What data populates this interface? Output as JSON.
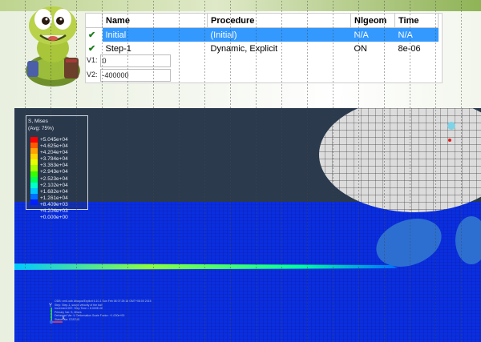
{
  "step_manager": {
    "columns": [
      "Name",
      "Procedure",
      "Nlgeom",
      "Time"
    ],
    "rows": [
      {
        "check": "✔",
        "name": "Initial",
        "procedure": "(Initial)",
        "nlgeom": "N/A",
        "time": "N/A",
        "selected": true
      },
      {
        "check": "✔",
        "name": "Step-1",
        "procedure": "Dynamic, Explicit",
        "nlgeom": "ON",
        "time": "8e-06",
        "selected": false
      }
    ]
  },
  "velocity_fields": [
    {
      "label": "V1:",
      "value": "0"
    },
    {
      "label": "V2:",
      "value": "-400000"
    }
  ],
  "legend": {
    "title_line1": "S, Mises",
    "title_line2": "(Avg: 75%)",
    "values": [
      "+5.045e+04",
      "+4.625e+04",
      "+4.204e+04",
      "+3.784e+04",
      "+3.363e+04",
      "+2.943e+04",
      "+2.523e+04",
      "+2.102e+04",
      "+1.682e+04",
      "+1.261e+04",
      "+8.409e+03",
      "+4.204e+03",
      "+0.000e+00"
    ],
    "colors": [
      "#ff0000",
      "#ff5a00",
      "#ffa200",
      "#ffd400",
      "#e8ff00",
      "#a8ff00",
      "#35ff00",
      "#00ff58",
      "#00ffcc",
      "#00c8ff",
      "#0070ff",
      "#0020ff",
      "#0000c8"
    ]
  },
  "odb_info": {
    "line1": "ODB: vm6.odb    Abaqus/Explicit 6.10-1    Sun Feb 08 07:25:18 GMT+08:00 2015",
    "line2": "Step: Step-1, susp4 velocity of the ball",
    "line3": "Increment    957: Step Time =  8.000E-06",
    "line4": "Primary Var: S, Mises",
    "line5": "Deformed Var: U   Deformation Scale Factor: +1.000e+00",
    "line6": "Status Var: STATUS"
  },
  "triad": {
    "y": "Y",
    "x": "X"
  },
  "theme": {
    "selected_row": "#3399ff",
    "viewport_bg": "#2b3a4d",
    "check_green": "#1f7d1f"
  }
}
